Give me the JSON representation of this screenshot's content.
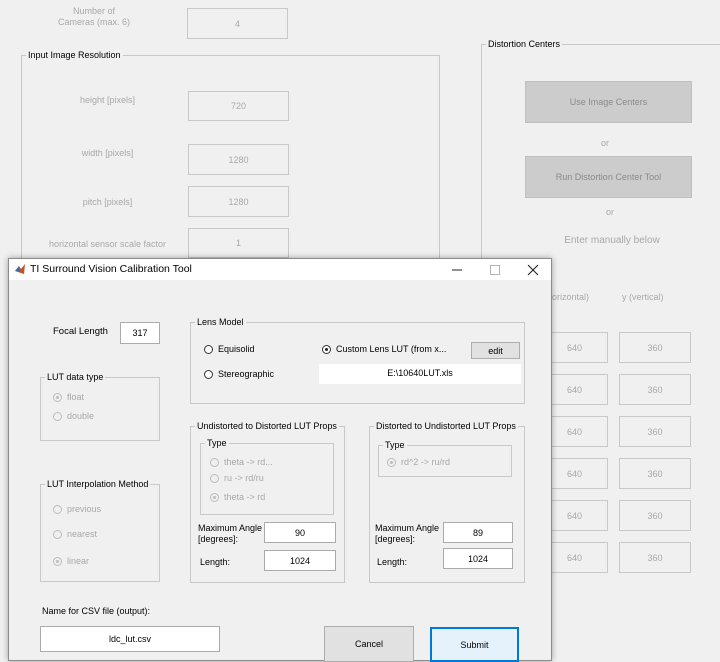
{
  "background": {
    "num_cameras_label": "Number of\nCameras (max. 6)",
    "num_cameras_value": "4",
    "input_res_title": "Input Image Resolution",
    "height_label": "height [pixels]",
    "height_value": "720",
    "width_label": "width [pixels]",
    "width_value": "1280",
    "pitch_label": "pitch [pixels]",
    "pitch_value": "1280",
    "hscale_label": "horizontal sensor scale factor",
    "hscale_value": "1",
    "distortion_title": "Distortion Centers",
    "use_image_centers": "Use Image Centers",
    "or1": "or",
    "run_tool": "Run Distortion Center Tool",
    "or2": "or",
    "enter_manually": "Enter manually below",
    "x_header": "orizontal)",
    "y_header": "y (vertical)",
    "x_values": [
      "640",
      "640",
      "640",
      "640",
      "640",
      "640"
    ],
    "y_values": [
      "360",
      "360",
      "360",
      "360",
      "360",
      "360"
    ]
  },
  "dialog": {
    "title": "TI Surround Vision Calibration Tool",
    "focal_length_label": "Focal Length",
    "focal_length_value": "317",
    "lut_type_title": "LUT data type",
    "lut_type_options": [
      "float",
      "double"
    ],
    "interp_title": "LUT Interpolation Method",
    "interp_options": [
      "previous",
      "nearest",
      "linear"
    ],
    "lens_model_title": "Lens Model",
    "lens_equisolid": "Equisolid",
    "lens_stereographic": "Stereographic",
    "lens_custom": "Custom Lens LUT (from x...",
    "edit_button": "edit",
    "lut_file": "E:\\10640LUT.xls",
    "u2d_title": "Undistorted to Distorted LUT Props",
    "u2d_type_title": "Type",
    "u2d_types": [
      "theta -> rd...",
      "ru -> rd/ru",
      "theta -> rd"
    ],
    "u2d_max_angle_label": "Maximum Angle\n[degrees]:",
    "u2d_max_angle": "90",
    "u2d_length_label": "Length:",
    "u2d_length": "1024",
    "d2u_title": "Distorted to Undistorted LUT Props",
    "d2u_type_title": "Type",
    "d2u_types": [
      "rd^2 -> ru/rd"
    ],
    "d2u_max_angle_label": "Maximum Angle\n[degrees]:",
    "d2u_max_angle": "89",
    "d2u_length_label": "Length:",
    "d2u_length": "1024",
    "csv_label": "Name for CSV file (output):",
    "csv_value": "ldc_lut.csv",
    "cancel": "Cancel",
    "submit": "Submit"
  }
}
